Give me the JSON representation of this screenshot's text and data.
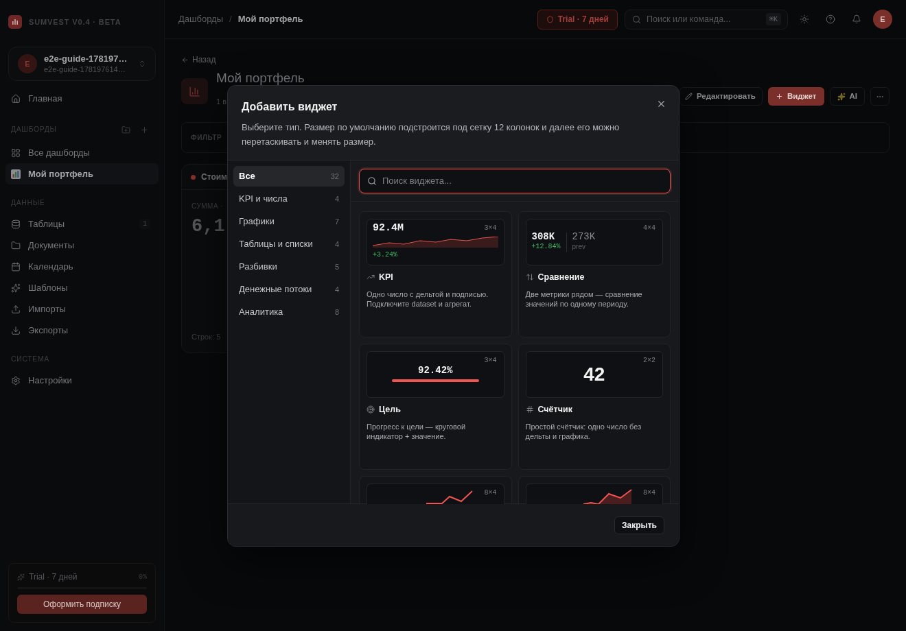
{
  "sidebar": {
    "brand": "SUMVEST V0.4 · BETA",
    "workspace": {
      "avatar": "E",
      "name": "e2e-guide-178197…",
      "id": "e2e-guide-178197614…"
    },
    "sections": [
      {
        "items": [
          {
            "label": "Главная",
            "selected": false
          }
        ]
      },
      {
        "title": "ДАШБОРДЫ",
        "items": [
          {
            "label": "Все дашборды",
            "selected": false
          },
          {
            "label": "Мой портфель",
            "selected": true
          }
        ]
      },
      {
        "title": "ДАННЫЕ",
        "items": [
          {
            "label": "Таблицы",
            "count": "1",
            "selected": false
          },
          {
            "label": "Документы",
            "selected": false
          },
          {
            "label": "Календарь",
            "selected": false
          },
          {
            "label": "Шаблоны",
            "selected": false
          },
          {
            "label": "Импорты",
            "selected": false
          },
          {
            "label": "Экспорты",
            "selected": false
          }
        ]
      },
      {
        "title": "СИСТЕМА",
        "items": [
          {
            "label": "Настройки",
            "selected": false
          }
        ]
      }
    ],
    "trial": {
      "label": "Trial · 7 дней",
      "percent": "0%",
      "level": 0,
      "button": "Оформить подписку"
    }
  },
  "topbar": {
    "breadcrumb": [
      {
        "label": "Дашборды",
        "current": false
      },
      {
        "label": "Мой портфель",
        "current": true
      }
    ],
    "separator": "/",
    "trial_badge": "Trial · 7 дней",
    "search": {
      "placeholder": "Поиск или команда...",
      "shortcut": "⌘K"
    },
    "avatar": "E"
  },
  "page": {
    "back": "Назад",
    "title": "Мой портфель",
    "subtitle": "1 в",
    "actions": [
      {
        "kind": "edit",
        "label": "Редактировать"
      },
      {
        "kind": "add",
        "label": "Виджет"
      },
      {
        "kind": "ai",
        "label": "AI"
      },
      {
        "kind": "more"
      }
    ],
    "filters": "ФИЛЬТР",
    "widget": {
      "title": "Стоим",
      "metric": "СУММА ·",
      "value": "6,1",
      "footer": "Строк: 5"
    }
  },
  "modal": {
    "title": "Добавить виджет",
    "description": "Выберите тип. Размер по умолчанию подстроится под сетку 12 колонок и далее его можно перетаскивать и менять размер.",
    "categories": [
      {
        "label": "Все",
        "count": "32",
        "selected": true
      },
      {
        "label": "KPI и числа",
        "count": "4",
        "selected": false
      },
      {
        "label": "Графики",
        "count": "7",
        "selected": false
      },
      {
        "label": "Таблицы и списки",
        "count": "4",
        "selected": false
      },
      {
        "label": "Разбивки",
        "count": "5",
        "selected": false
      },
      {
        "label": "Денежные потоки",
        "count": "4",
        "selected": false
      },
      {
        "label": "Аналитика",
        "count": "8",
        "selected": false
      }
    ],
    "search": {
      "placeholder": "Поиск виджета...",
      "focused": true
    },
    "widgets": [
      {
        "kind": "kpi",
        "size": "3×4",
        "name": "KPI",
        "description": "Одно число с дельтой и подписью. Подключите dataset и агрегат.",
        "preview": {
          "value": "92.4M",
          "delta": "+3.24%"
        }
      },
      {
        "kind": "comparison",
        "size": "4×4",
        "name": "Сравнение",
        "description": "Две метрики рядом — сравнение значений по одному периоду.",
        "preview": {
          "value": "308K",
          "delta": "+12.84%",
          "previous": "273K",
          "previous_label": "prev"
        }
      },
      {
        "kind": "goal",
        "size": "3×4",
        "name": "Цель",
        "description": "Прогресс к цели — круговой индикатор + значение.",
        "preview": {
          "value": "92.42%"
        }
      },
      {
        "kind": "counter",
        "size": "2×2",
        "name": "Счётчик",
        "description": "Простой счётчик: одно число без дельты и графика.",
        "preview": {
          "value": "42"
        }
      },
      {
        "kind": "line",
        "size": "8×4"
      },
      {
        "kind": "area",
        "size": "8×4"
      }
    ],
    "close_button": "Закрыть"
  }
}
